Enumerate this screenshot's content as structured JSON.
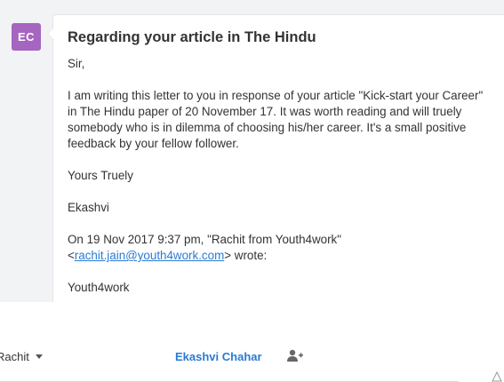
{
  "message": {
    "avatar_initials": "EC",
    "avatar_color": "#a565c0",
    "subject": "Regarding your article in The Hindu",
    "body": {
      "salutation": "Sir,",
      "paragraph": "I am writing this letter to you in response of your article \"Kick-start your Career\" in The Hindu paper of 20 November 17. It was worth reading and will truely somebody who is in dilemma of choosing his/her career. It's a small positive feedback by your fellow follower.",
      "closing": "Yours Truely",
      "signature": "Ekashvi",
      "quote_intro": "On 19 Nov 2017 9:37 pm, \"Rachit from Youth4work\"",
      "quote_open": "<",
      "quote_email": "rachit.jain@youth4work.com",
      "quote_close": "> wrote:",
      "quoted_text": "Youth4work"
    }
  },
  "compose": {
    "from_label": "Rachit",
    "from_icon": "chevron-down-icon",
    "to_name": "Ekashvi Chahar",
    "add_recipient_icon": "add-person-icon",
    "resize_icon": "resize-triangle-icon"
  },
  "colors": {
    "link": "#2a7bd3",
    "text": "#333333",
    "thread_background": "#f2f3f5"
  }
}
